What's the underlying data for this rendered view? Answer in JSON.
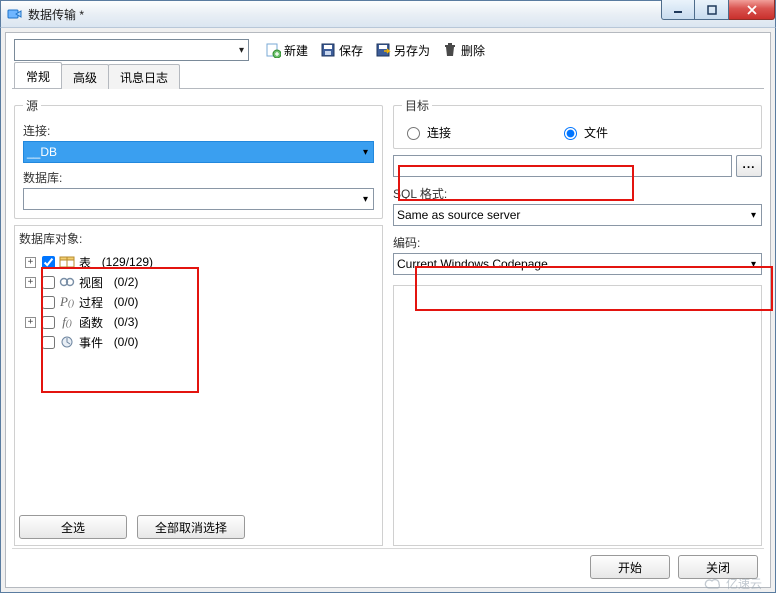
{
  "window": {
    "title": "数据传输 *"
  },
  "toolbar": {
    "new_label": "新建",
    "save_label": "保存",
    "saveas_label": "另存为",
    "delete_label": "删除"
  },
  "tabs": {
    "general": "常规",
    "advanced": "高级",
    "log": "讯息日志"
  },
  "source": {
    "legend": "源",
    "connection_label": "连接:",
    "connection_value": "__DB",
    "database_label": "数据库:",
    "database_value": "",
    "objects_label": "数据库对象:",
    "tree": {
      "tables": {
        "label": "表",
        "count": "(129/129)"
      },
      "views": {
        "label": "视图",
        "count": "(0/2)"
      },
      "procedures": {
        "label": "过程",
        "count": "(0/0)"
      },
      "functions": {
        "label": "函数",
        "count": "(0/3)"
      },
      "events": {
        "label": "事件",
        "count": "(0/0)"
      }
    },
    "select_all": "全选",
    "deselect_all": "全部取消选择"
  },
  "target": {
    "legend": "目标",
    "opt_connection": "连接",
    "opt_file": "文件",
    "file_value": "",
    "sqlformat_label": "SQL 格式:",
    "sqlformat_value": "Same as source server",
    "encoding_label": "编码:",
    "encoding_value": "Current Windows Codepage"
  },
  "footer": {
    "start": "开始",
    "close": "关闭"
  },
  "watermark": "亿速云"
}
